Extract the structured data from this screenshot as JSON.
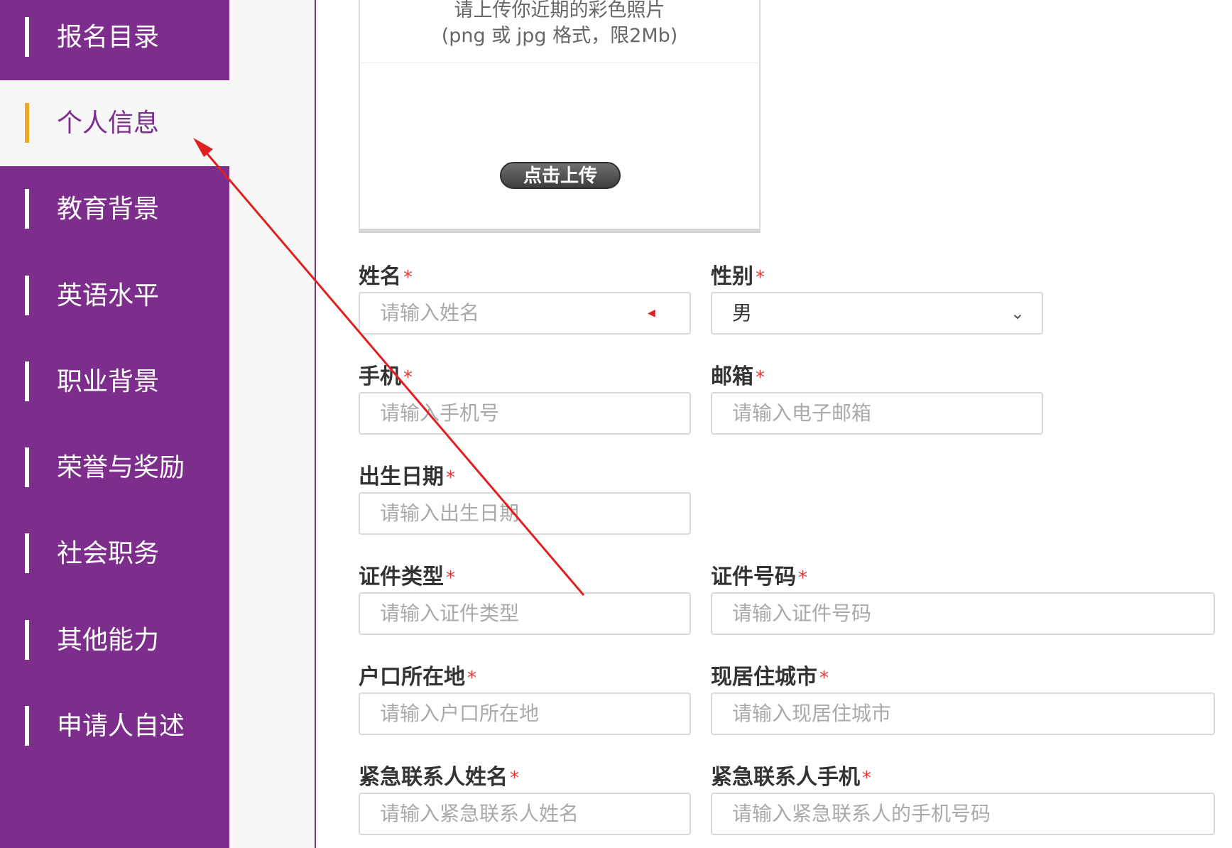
{
  "sidebar": {
    "items": [
      {
        "label": "报名目录",
        "active": false
      },
      {
        "label": "个人信息",
        "active": true
      },
      {
        "label": "教育背景",
        "active": false
      },
      {
        "label": "英语水平",
        "active": false
      },
      {
        "label": "职业背景",
        "active": false
      },
      {
        "label": "荣誉与奖励",
        "active": false
      },
      {
        "label": "社会职务",
        "active": false
      },
      {
        "label": "其他能力",
        "active": false
      },
      {
        "label": "申请人自述",
        "active": false
      }
    ]
  },
  "photo": {
    "hint_line1": "请上传你近期的彩色照片",
    "hint_line2": "(png 或 jpg 格式，限2Mb)",
    "upload_label": "点击上传"
  },
  "form": {
    "required_mark": "*",
    "name": {
      "label": "姓名",
      "placeholder": "请输入姓名"
    },
    "gender": {
      "label": "性别",
      "value": "男"
    },
    "phone": {
      "label": "手机",
      "placeholder": "请输入手机号"
    },
    "email": {
      "label": "邮箱",
      "placeholder": "请输入电子邮箱"
    },
    "birthdate": {
      "label": "出生日期",
      "placeholder": "请输入出生日期"
    },
    "id_type": {
      "label": "证件类型",
      "placeholder": "请输入证件类型"
    },
    "id_number": {
      "label": "证件号码",
      "placeholder": "请输入证件号码"
    },
    "hukou": {
      "label": "户口所在地",
      "placeholder": "请输入户口所在地"
    },
    "city": {
      "label": "现居住城市",
      "placeholder": "请输入现居住城市"
    },
    "emergency_name": {
      "label": "紧急联系人姓名",
      "placeholder": "请输入紧急联系人姓名"
    },
    "emergency_phone": {
      "label": "紧急联系人手机",
      "placeholder": "请输入紧急联系人的手机号码"
    }
  },
  "colors": {
    "sidebar_bg": "#7d2d8c",
    "active_indicator": "#f5a623",
    "required": "#e23b3b",
    "annotation": "#e02020"
  }
}
